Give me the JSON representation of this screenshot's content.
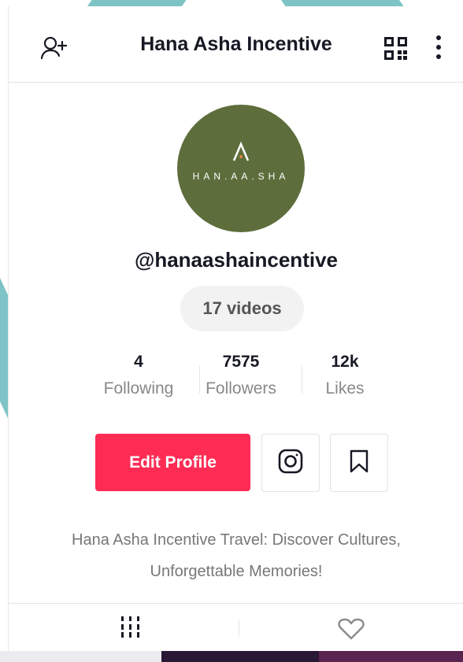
{
  "header": {
    "title": "Hana Asha Incentive",
    "icons": [
      "add-user-icon",
      "qr-code-icon",
      "more-vertical-icon"
    ]
  },
  "profile": {
    "avatar_logo_text": "HAN.AA.SHA",
    "handle": "@hanaashaincentive",
    "videos": "17 videos"
  },
  "stats": {
    "following": {
      "value": "4",
      "label": "Following"
    },
    "followers": {
      "value": "7575",
      "label": "Followers"
    },
    "likes": {
      "value": "12k",
      "label": "Likes"
    }
  },
  "actions": {
    "edit_label": "Edit Profile",
    "icons": [
      "instagram-icon",
      "bookmark-icon"
    ]
  },
  "bio": "Hana Asha Incentive Travel: Discover Cultures, Unforgettable Memories!",
  "tabs": {
    "icons": [
      "videos-grid-icon",
      "liked-heart-icon"
    ]
  },
  "colors": {
    "accent": "#fe2c55",
    "avatar_bg": "#5d6e3c",
    "background_stripe": "#7ec4c6"
  }
}
